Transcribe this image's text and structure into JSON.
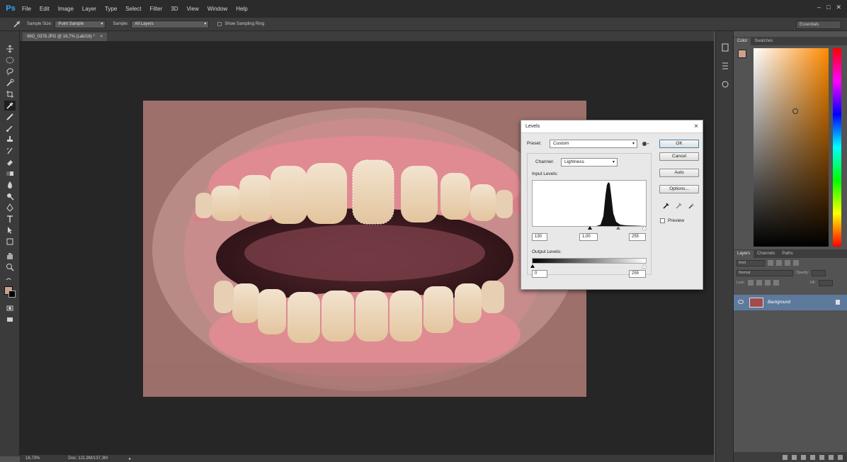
{
  "app": {
    "logo": "Ps",
    "menu": [
      "File",
      "Edit",
      "Image",
      "Layer",
      "Type",
      "Select",
      "Filter",
      "3D",
      "View",
      "Window",
      "Help"
    ]
  },
  "options_bar": {
    "sample_size_label": "Sample Size:",
    "sample_size_value": "Point Sample",
    "sample_label": "Sample:",
    "sample_value": "All Layers",
    "show_ring_label": "Show Sampling Ring",
    "workspace": "Essentials"
  },
  "document": {
    "tab_title": "IMG_0378.JPG @ 16,7% (Lab/16) *",
    "tab_close": "×"
  },
  "status_bar": {
    "zoom": "16,73%",
    "doc_info": "Doc: 121,9M/137,3M"
  },
  "levels_dialog": {
    "title": "Levels",
    "close": "×",
    "preset_label": "Preset:",
    "preset_value": "Custom",
    "channel_label": "Channel:",
    "channel_value": "Lightness",
    "input_levels_label": "Input Levels:",
    "input_black": "130",
    "input_gamma": "1,00",
    "input_white": "255",
    "output_levels_label": "Output Levels:",
    "output_black": "0",
    "output_white": "255",
    "buttons": {
      "ok": "OK",
      "cancel": "Cancel",
      "auto": "Auto",
      "options": "Options..."
    },
    "preview_label": "Preview",
    "preview_checked": false
  },
  "color_panel": {
    "tabs": [
      "Color",
      "Swatches"
    ],
    "foreground": "#c8a28c",
    "background": "#000000"
  },
  "layers_panel": {
    "tabs": [
      "Layers",
      "Channels",
      "Paths"
    ],
    "kind_filter": "Kind",
    "blend_mode": "Normal",
    "opacity_label": "Opacity:",
    "lock_label": "Lock:",
    "fill_label": "Fill:",
    "layer_name": "Background"
  },
  "colors": {
    "menubar": "#2b2b2b",
    "panel": "#535353",
    "canvas_bg": "#262626",
    "layer_selected": "#5d7a9c"
  },
  "icons": {
    "tools": [
      "move-icon",
      "marquee-icon",
      "lasso-icon",
      "quick-select-icon",
      "crop-icon",
      "eyedropper-icon",
      "healing-brush-icon",
      "brush-icon",
      "clone-stamp-icon",
      "history-brush-icon",
      "eraser-icon",
      "gradient-icon",
      "blur-icon",
      "dodge-icon",
      "pen-icon",
      "type-icon",
      "path-select-icon",
      "shape-icon",
      "hand-icon",
      "zoom-icon"
    ]
  }
}
